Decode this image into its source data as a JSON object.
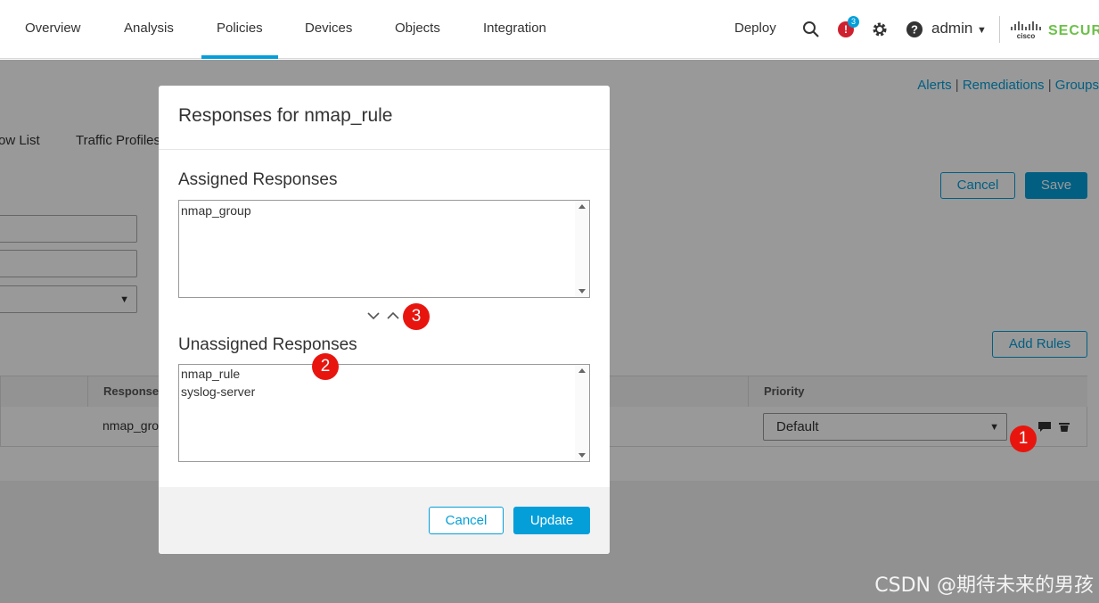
{
  "nav": {
    "tabs": [
      "Overview",
      "Analysis",
      "Policies",
      "Devices",
      "Objects",
      "Integration"
    ],
    "active_tab": "Policies",
    "deploy": "Deploy",
    "alert_badge_icon": "!",
    "alert_count": "3",
    "user": "admin",
    "brand": "SECUR"
  },
  "background": {
    "links": [
      "Alerts",
      "Remediations",
      "Groups"
    ],
    "subtabs": [
      "ow List",
      "Traffic Profiles"
    ],
    "cancel": "Cancel",
    "save": "Save",
    "add_rules": "Add Rules",
    "table_headers": {
      "responses": "Responses",
      "priority": "Priority"
    },
    "row": {
      "responses": "nmap_grou",
      "priority": "Default"
    }
  },
  "modal": {
    "title": "Responses for nmap_rule",
    "assigned_label": "Assigned Responses",
    "assigned_items": [
      "nmap_group"
    ],
    "unassigned_label": "Unassigned Responses",
    "unassigned_items": [
      "nmap_rule",
      "syslog-server"
    ],
    "cancel": "Cancel",
    "update": "Update"
  },
  "markers": [
    "1",
    "2",
    "3"
  ],
  "watermark": "CSDN @期待未来的男孩",
  "colors": {
    "accent": "#049fd9",
    "marker": "#e8150f",
    "alert": "#cf2030",
    "brand": "#6cc04a"
  }
}
